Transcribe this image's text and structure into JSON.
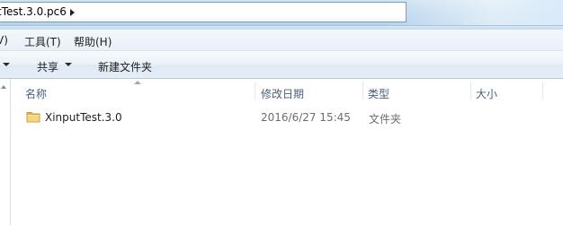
{
  "address": {
    "path_text": "tTest.3.0.pc6"
  },
  "menu": {
    "items": [
      {
        "label": "V)"
      },
      {
        "label": "工具(T)"
      },
      {
        "label": "帮助(H)"
      }
    ]
  },
  "commandbar": {
    "share_label": "共享",
    "new_folder_label": "新建文件夹"
  },
  "columns": {
    "name": "名称",
    "modified": "修改日期",
    "type": "类型",
    "size": "大小"
  },
  "files": [
    {
      "name": "XinputTest.3.0",
      "modified": "2016/6/27 15:45",
      "type": "文件夹",
      "size": "",
      "icon": "folder-icon"
    }
  ]
}
